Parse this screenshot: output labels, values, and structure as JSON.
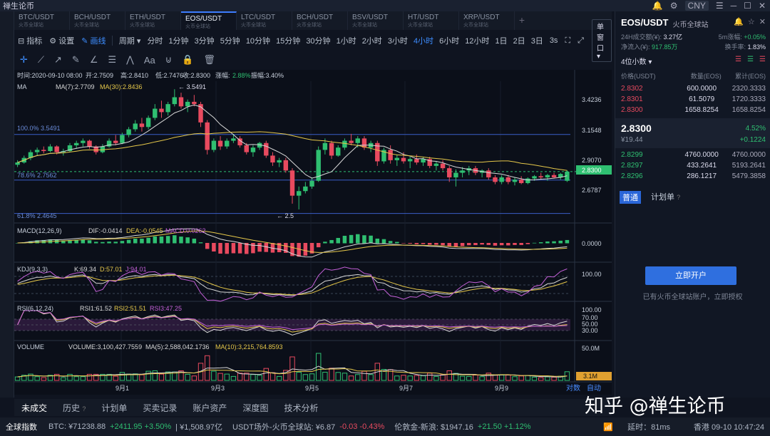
{
  "titlebar": {
    "app_name": "禅生论币",
    "currency": "CNY"
  },
  "tabs": [
    {
      "symbol": "BTC/USDT",
      "sub": "火币全球站"
    },
    {
      "symbol": "BCH/USDT",
      "sub": "火币全球站"
    },
    {
      "symbol": "ETH/USDT",
      "sub": "火币全球站"
    },
    {
      "symbol": "EOS/USDT",
      "sub": "火币全球站",
      "active": true
    },
    {
      "symbol": "LTC/USDT",
      "sub": "火币全球站"
    },
    {
      "symbol": "BCH/USDT",
      "sub": "火币全球站"
    },
    {
      "symbol": "BSV/USDT",
      "sub": "火币全球站"
    },
    {
      "symbol": "HT/USDT",
      "sub": "火币全球站"
    },
    {
      "symbol": "XRP/USDT",
      "sub": "火币全球站"
    }
  ],
  "toolbar": {
    "indicators": "指标",
    "settings": "设置",
    "draw": "画线",
    "period": "周期",
    "intervals": [
      "分时",
      "1分钟",
      "3分钟",
      "5分钟",
      "10分钟",
      "15分钟",
      "30分钟",
      "1小时",
      "2小时",
      "3小时",
      "4小时",
      "6小时",
      "12小时",
      "1日",
      "2日",
      "3日"
    ],
    "active_interval": "4小时",
    "speed": "3s",
    "window_mode": "单窗口"
  },
  "ohlc_header": {
    "time": "时间:2020-09-10 08:00",
    "open": "开:2.7509",
    "high": "高:2.8410",
    "low": "低:2.7476",
    "close": "收:2.8300",
    "change_label": "涨幅:",
    "change": "2.88%",
    "amplitude": "振幅:3.40%"
  },
  "ma_header": {
    "name": "MA",
    "ma7": "MA(7):2.7709",
    "ma30": "MA(30):2.8436"
  },
  "macd_header": {
    "name": "MACD(12,26,9)",
    "dif": "DIF:-0.0414",
    "dea": "DEA:-0.0545",
    "macd": "MACD:0.0262"
  },
  "kdj_header": {
    "name": "KDJ(9,3,3)",
    "k": "K:69.34",
    "d": "D:57.01",
    "j": "J:94.01"
  },
  "rsi_header": {
    "name": "RSI(6,12,24)",
    "rsi1": "RSI1:61.52",
    "rsi2": "RSI2:51.51",
    "rsi3": "RSI3:47.25"
  },
  "vol_header": {
    "name": "VOLUME",
    "volume": "VOLUME:3,100,427.7559",
    "ma5": "MA(5):2,588,042.1736",
    "ma10": "MA(10):3,215,764.8593"
  },
  "annotations": {
    "high_label": "← 3.5491",
    "low_label": "← 2.5",
    "fib100": "100.0% 3.5491",
    "fib786": "78.6% 2.7562",
    "fib618": "61.8% 2.4645"
  },
  "price_axis": [
    "3.4236",
    "3.1548",
    "2.9070",
    "2.6787"
  ],
  "current_price_tag": "2.8300",
  "macd_axis": "0.0000",
  "kdj_axis": "100.00",
  "rsi_axis": [
    "100.00",
    "70.00",
    "50.00",
    "30.00"
  ],
  "vol_axis": "50.0M",
  "vol_tag": "3.1M",
  "dates": [
    "9月1",
    "9月3",
    "9月5",
    "9月7",
    "9月9"
  ],
  "corner": {
    "ratio": "对数",
    "auto": "自动"
  },
  "right_panel": {
    "pair": "EOS/USDT",
    "exchange": "火币全球站",
    "vol_label": "24H成交额(¥):",
    "vol_value": "3.27亿",
    "inflow_label": "净流入(¥):",
    "inflow_value": "917.85万",
    "range_label": "5m涨幅:",
    "range_value": "+0.05%",
    "turnover_label": "换手率:",
    "turnover_value": "1.83%",
    "decimals": "4位小数",
    "col_price": "价格(USDT)",
    "col_qty": "数量(EOS)",
    "col_total": "累计(EOS)",
    "asks": [
      [
        "2.8302",
        "600.0000",
        "2320.3333"
      ],
      [
        "2.8301",
        "61.5079",
        "1720.3333"
      ],
      [
        "2.8300",
        "1658.8254",
        "1658.8254"
      ]
    ],
    "last_price": "2.8300",
    "last_cny": "¥19.44",
    "pct": "4.52%",
    "delta": "+0.1224",
    "bids": [
      [
        "2.8299",
        "4760.0000",
        "4760.0000"
      ],
      [
        "2.8297",
        "433.2641",
        "5193.2641"
      ],
      [
        "2.8296",
        "286.1217",
        "5479.3858"
      ]
    ],
    "order_tab_normal": "普通",
    "order_tab_plan": "计划单",
    "open_button": "立即开户",
    "auth_text": "已有火币全球站账户，立即授权"
  },
  "bottom_tabs": [
    "未成交",
    "历史",
    "计划单",
    "买卖记录",
    "账户资产",
    "深度图",
    "技术分析"
  ],
  "status": {
    "index_label": "全球指数",
    "btc": "BTC: ¥71238.88",
    "btc_chg": "+2411.95 +3.50%",
    "btc_vol": "| ¥1,508.97亿",
    "usdt": "USDT场外-火币全球站: ¥6.87",
    "usdt_chg": "-0.03 -0.43%",
    "gold": "伦敦金-新浪: $1947.16",
    "gold_chg": "+21.50 +1.12%",
    "latency": "延时：81ms",
    "tz": "香港 09-10 10:47:24"
  },
  "watermark": "知乎 @禅生论币",
  "candles": [
    [
      2.89,
      2.93,
      2.87,
      2.91
    ],
    [
      2.91,
      2.97,
      2.9,
      2.95
    ],
    [
      2.95,
      3.02,
      2.93,
      3.0
    ],
    [
      3.0,
      3.04,
      2.97,
      3.02
    ],
    [
      3.02,
      3.05,
      2.99,
      3.01
    ],
    [
      3.01,
      3.07,
      3.0,
      3.05
    ],
    [
      3.05,
      3.06,
      2.98,
      3.0
    ],
    [
      3.0,
      3.03,
      2.97,
      3.01
    ],
    [
      3.01,
      3.08,
      3.0,
      3.06
    ],
    [
      3.06,
      3.1,
      3.03,
      3.08
    ],
    [
      3.08,
      3.12,
      3.05,
      3.1
    ],
    [
      3.1,
      3.11,
      3.03,
      3.05
    ],
    [
      3.05,
      3.06,
      2.98,
      3.0
    ],
    [
      3.0,
      3.07,
      2.99,
      3.05
    ],
    [
      3.05,
      3.12,
      3.04,
      3.1
    ],
    [
      3.1,
      3.15,
      3.06,
      3.08
    ],
    [
      3.08,
      3.17,
      3.07,
      3.15
    ],
    [
      3.15,
      3.22,
      3.13,
      3.2
    ],
    [
      3.2,
      3.28,
      3.18,
      3.25
    ],
    [
      3.25,
      3.3,
      3.18,
      3.22
    ],
    [
      3.22,
      3.32,
      3.2,
      3.3
    ],
    [
      3.3,
      3.42,
      3.28,
      3.38
    ],
    [
      3.38,
      3.45,
      3.3,
      3.35
    ],
    [
      3.35,
      3.44,
      3.32,
      3.42
    ],
    [
      3.42,
      3.55,
      3.4,
      3.48
    ],
    [
      3.48,
      3.52,
      3.38,
      3.4
    ],
    [
      3.4,
      3.46,
      3.35,
      3.44
    ],
    [
      3.44,
      3.5,
      3.4,
      3.42
    ],
    [
      3.42,
      3.44,
      3.22,
      3.26
    ],
    [
      3.26,
      3.28,
      2.98,
      3.02
    ],
    [
      3.02,
      3.12,
      3.0,
      3.1
    ],
    [
      3.1,
      3.14,
      3.02,
      3.05
    ],
    [
      3.05,
      3.12,
      3.03,
      3.1
    ],
    [
      3.1,
      3.16,
      3.08,
      3.12
    ],
    [
      3.12,
      3.14,
      3.04,
      3.06
    ],
    [
      3.06,
      3.08,
      2.98,
      3.0
    ],
    [
      3.0,
      3.06,
      2.96,
      3.04
    ],
    [
      3.04,
      3.09,
      3.02,
      3.08
    ],
    [
      3.08,
      3.1,
      2.95,
      2.97
    ],
    [
      2.97,
      3.0,
      2.88,
      2.91
    ],
    [
      2.91,
      2.95,
      2.87,
      2.93
    ],
    [
      2.93,
      2.95,
      2.82,
      2.84
    ],
    [
      2.84,
      2.86,
      2.55,
      2.62
    ],
    [
      2.62,
      2.7,
      2.5,
      2.66
    ],
    [
      2.66,
      2.74,
      2.64,
      2.7
    ],
    [
      2.7,
      2.78,
      2.68,
      2.75
    ],
    [
      2.75,
      3.05,
      2.74,
      3.02
    ],
    [
      3.02,
      3.12,
      2.98,
      3.08
    ],
    [
      3.08,
      3.1,
      2.94,
      2.97
    ],
    [
      2.97,
      3.06,
      2.96,
      3.04
    ],
    [
      3.04,
      3.12,
      3.02,
      3.1
    ],
    [
      3.1,
      3.16,
      3.06,
      3.08
    ],
    [
      3.08,
      3.14,
      3.04,
      3.12
    ],
    [
      3.12,
      3.14,
      3.02,
      3.04
    ],
    [
      3.04,
      3.1,
      3.0,
      3.08
    ],
    [
      3.08,
      3.1,
      2.88,
      2.92
    ],
    [
      2.92,
      3.04,
      2.9,
      3.02
    ],
    [
      3.02,
      3.06,
      2.9,
      2.93
    ],
    [
      2.93,
      2.98,
      2.88,
      2.95
    ],
    [
      2.95,
      3.0,
      2.9,
      2.92
    ],
    [
      2.92,
      2.96,
      2.86,
      2.94
    ],
    [
      2.94,
      2.98,
      2.89,
      2.91
    ],
    [
      2.91,
      2.96,
      2.88,
      2.94
    ],
    [
      2.94,
      2.96,
      2.86,
      2.88
    ],
    [
      2.88,
      2.92,
      2.84,
      2.9
    ],
    [
      2.9,
      2.93,
      2.84,
      2.86
    ],
    [
      2.86,
      2.88,
      2.74,
      2.78
    ],
    [
      2.78,
      2.85,
      2.7,
      2.82
    ],
    [
      2.82,
      2.87,
      2.78,
      2.84
    ],
    [
      2.84,
      2.88,
      2.8,
      2.86
    ],
    [
      2.86,
      2.88,
      2.8,
      2.82
    ],
    [
      2.82,
      2.85,
      2.78,
      2.84
    ],
    [
      2.84,
      2.86,
      2.76,
      2.78
    ],
    [
      2.78,
      2.8,
      2.72,
      2.74
    ],
    [
      2.74,
      2.8,
      2.72,
      2.78
    ],
    [
      2.78,
      2.8,
      2.72,
      2.74
    ],
    [
      2.74,
      2.78,
      2.71,
      2.76
    ],
    [
      2.76,
      2.79,
      2.72,
      2.73
    ],
    [
      2.73,
      2.78,
      2.72,
      2.77
    ],
    [
      2.77,
      2.8,
      2.75,
      2.79
    ],
    [
      2.79,
      2.82,
      2.76,
      2.78
    ],
    [
      2.78,
      2.81,
      2.75,
      2.8
    ],
    [
      2.8,
      2.82,
      2.77,
      2.78
    ],
    [
      2.78,
      2.82,
      2.76,
      2.81
    ],
    [
      2.75,
      2.84,
      2.74,
      2.83
    ]
  ]
}
